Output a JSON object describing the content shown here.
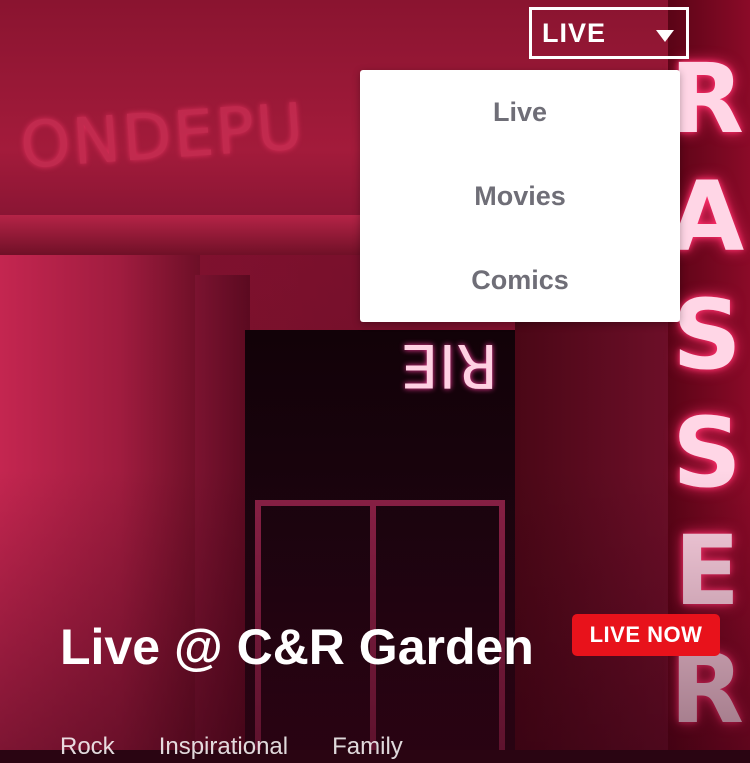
{
  "selector": {
    "label": "LIVE",
    "icon": "caret-down-icon"
  },
  "dropdown": {
    "items": [
      {
        "label": "Live"
      },
      {
        "label": "Movies"
      },
      {
        "label": "Comics"
      }
    ]
  },
  "hero": {
    "title": "Live @ C&R Garden",
    "badge": "LIVE NOW",
    "badge_color": "#e8121b",
    "tags": [
      "Rock",
      "Inspirational",
      "Family"
    ]
  }
}
